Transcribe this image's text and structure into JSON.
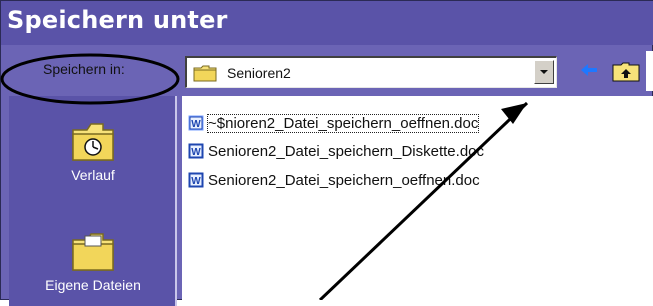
{
  "dialog": {
    "title": "Speichern unter",
    "save_in_label": "Speichern in:",
    "folder": "Senioren2"
  },
  "sidebar": {
    "items": [
      {
        "label": "Verlauf",
        "icon": "history-folder-icon"
      },
      {
        "label": "Eigene Dateien",
        "icon": "my-documents-folder-icon"
      }
    ]
  },
  "files": [
    {
      "name": "~$nioren2_Datei_speichern_oeffnen.doc",
      "icon": "word-doc-icon",
      "selected": true
    },
    {
      "name": "Senioren2_Datei_speichern_Diskette.doc",
      "icon": "word-doc-icon",
      "selected": false
    },
    {
      "name": "Senioren2_Datei_speichern_oeffnen.doc",
      "icon": "word-doc-icon",
      "selected": false
    }
  ],
  "colors": {
    "dialog_bg": "#6b64b5",
    "sidebar_bg": "#5a53a8",
    "list_bg": "#ffffff"
  }
}
